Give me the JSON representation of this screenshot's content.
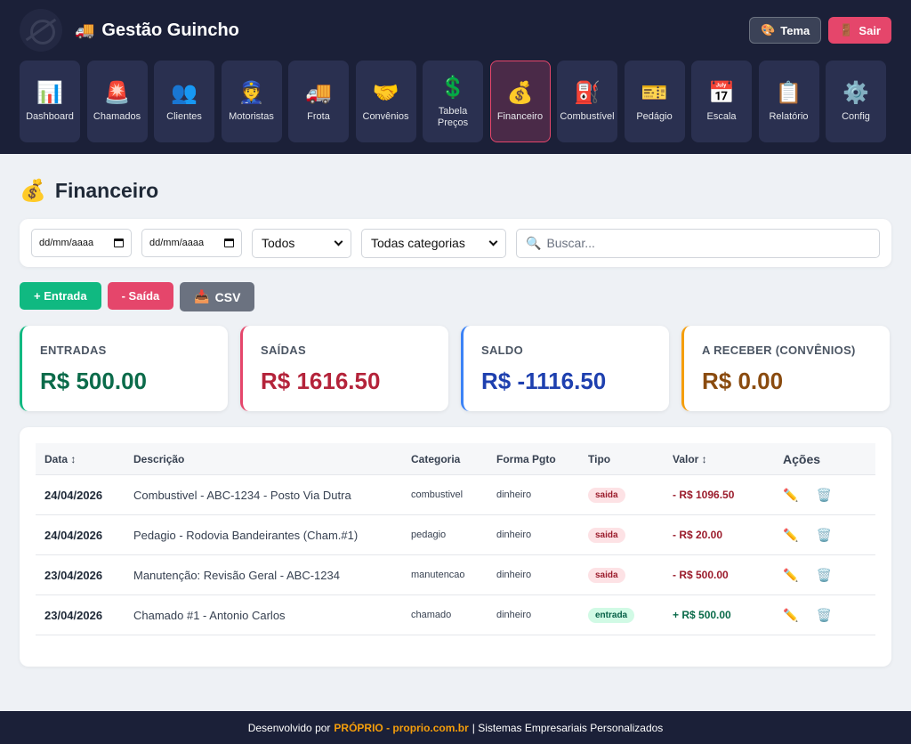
{
  "app": {
    "title": "Gestão Guincho",
    "truck_icon": "🚚",
    "logo_icon": "crosshair-logo"
  },
  "top_actions": {
    "tema_icon": "🎨",
    "tema_label": "Tema",
    "sair_icon": "🚪",
    "sair_label": "Sair"
  },
  "nav": [
    {
      "id": "dashboard",
      "icon": "📊",
      "label": "Dashboard",
      "active": false
    },
    {
      "id": "chamados",
      "icon": "🚨",
      "label": "Chamados",
      "active": false
    },
    {
      "id": "clientes",
      "icon": "👥",
      "label": "Clientes",
      "active": false
    },
    {
      "id": "motoristas",
      "icon": "👮",
      "label": "Motoristas",
      "active": false
    },
    {
      "id": "frota",
      "icon": "🚚",
      "label": "Frota",
      "active": false
    },
    {
      "id": "convenios",
      "icon": "🤝",
      "label": "Convênios",
      "active": false
    },
    {
      "id": "tabela-precos",
      "icon": "💲",
      "label": "Tabela Preços",
      "active": false
    },
    {
      "id": "financeiro",
      "icon": "💰",
      "label": "Financeiro",
      "active": true
    },
    {
      "id": "combustivel",
      "icon": "⛽",
      "label": "Combustível",
      "active": false
    },
    {
      "id": "pedagio",
      "icon": "🎫",
      "label": "Pedágio",
      "active": false
    },
    {
      "id": "escala",
      "icon": "📅",
      "label": "Escala",
      "active": false
    },
    {
      "id": "relatorio",
      "icon": "📋",
      "label": "Relatório",
      "active": false
    },
    {
      "id": "config",
      "icon": "⚙️",
      "label": "Config",
      "active": false
    }
  ],
  "page": {
    "icon": "💰",
    "title": "Financeiro"
  },
  "filters": {
    "date_from_placeholder": "dd/mm/aaaa",
    "date_to_placeholder": "dd/mm/aaaa",
    "type_selected": "Todos",
    "category_selected": "Todas categorias",
    "search_icon": "🔍",
    "search_placeholder": "Buscar..."
  },
  "actions": {
    "entrada_label": "+ Entrada",
    "saida_label": "- Saída",
    "csv_icon": "📥",
    "csv_label": "CSV"
  },
  "summary": {
    "entradas_label": "ENTRADAS",
    "entradas_value": "R$ 500.00",
    "saidas_label": "SAÍDAS",
    "saidas_value": "R$ 1616.50",
    "saldo_label": "SALDO",
    "saldo_value": "R$ -1116.50",
    "receber_label": "A RECEBER (CONVÊNIOS)",
    "receber_value": "R$ 0.00"
  },
  "table": {
    "headers": {
      "data": "Data ↕",
      "descricao": "Descrição",
      "categoria": "Categoria",
      "forma": "Forma Pgto",
      "tipo": "Tipo",
      "valor": "Valor ↕",
      "acoes": "Ações"
    },
    "rows": [
      {
        "data": "24/04/2026",
        "descricao": "Combustivel - ABC-1234 - Posto Via Dutra",
        "categoria": "combustivel",
        "forma": "dinheiro",
        "tipo": "saida",
        "valor": "- R$ 1096.50"
      },
      {
        "data": "24/04/2026",
        "descricao": "Pedagio - Rodovia Bandeirantes (Cham.#1)",
        "categoria": "pedagio",
        "forma": "dinheiro",
        "tipo": "saida",
        "valor": "- R$ 20.00"
      },
      {
        "data": "23/04/2026",
        "descricao": "Manutenção: Revisão Geral - ABC-1234",
        "categoria": "manutencao",
        "forma": "dinheiro",
        "tipo": "saida",
        "valor": "- R$ 500.00"
      },
      {
        "data": "23/04/2026",
        "descricao": "Chamado #1 - Antonio Carlos",
        "categoria": "chamado",
        "forma": "dinheiro",
        "tipo": "entrada",
        "valor": "+ R$ 500.00"
      }
    ],
    "edit_icon": "✏️",
    "delete_icon": "🗑️"
  },
  "footer": {
    "prefix": "Desenvolvido por",
    "brand": "PRÓPRIO - proprio.com.br",
    "suffix": "| Sistemas Empresariais Personalizados"
  }
}
